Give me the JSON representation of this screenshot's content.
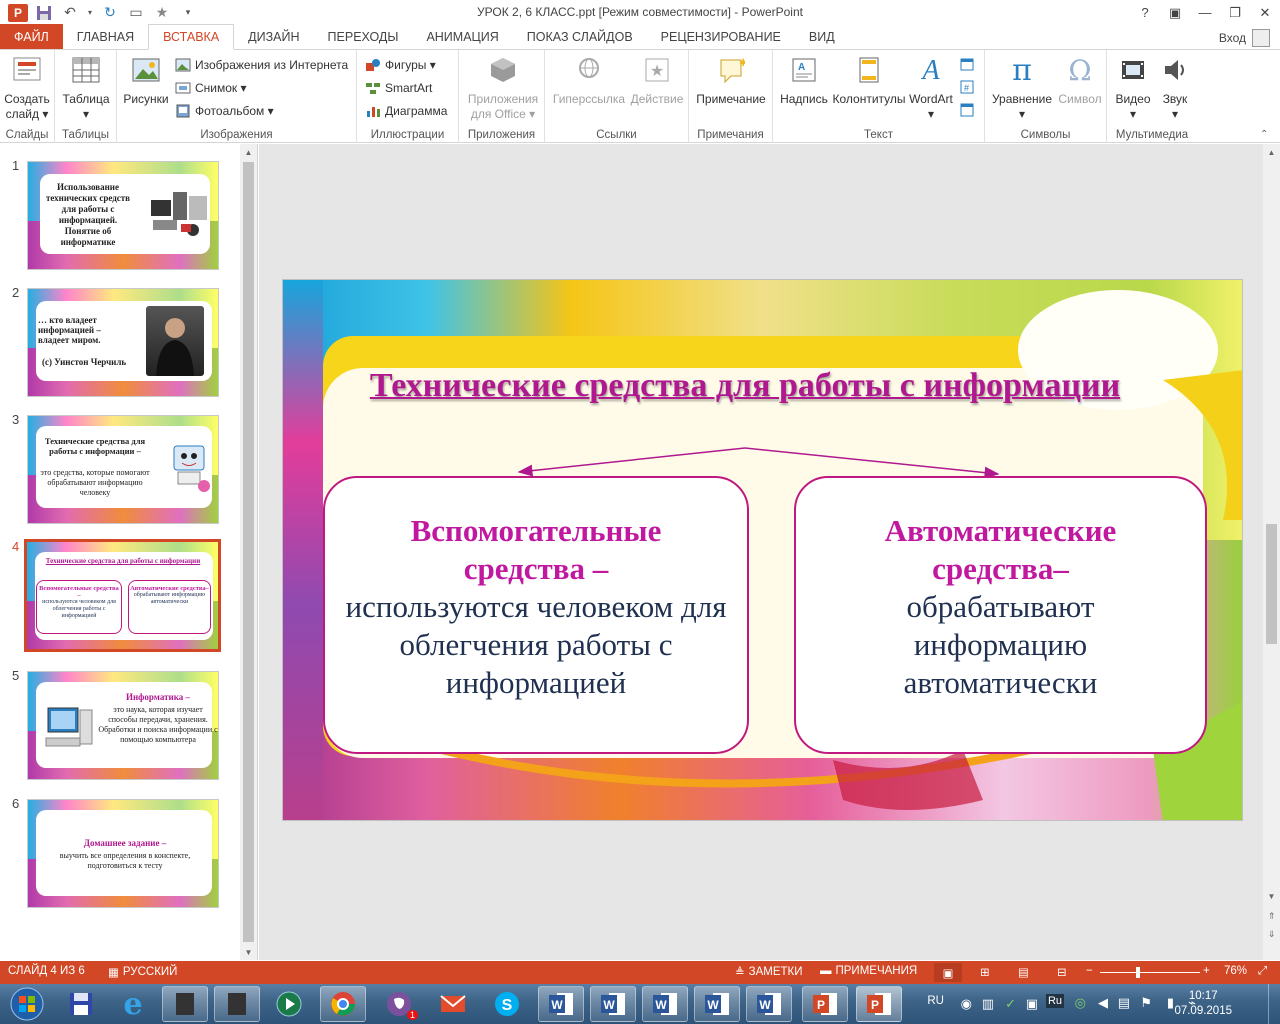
{
  "window": {
    "title": "УРОК 2, 6 КЛАСС.ppt [Режим совместимости] - PowerPoint",
    "controls": [
      "?",
      "▣",
      "—",
      "❐",
      "✕"
    ]
  },
  "tabs": {
    "file": "ФАЙЛ",
    "items": [
      "ГЛАВНАЯ",
      "ВСТАВКА",
      "ДИЗАЙН",
      "ПЕРЕХОДЫ",
      "АНИМАЦИЯ",
      "ПОКАЗ СЛАЙДОВ",
      "РЕЦЕНЗИРОВАНИЕ",
      "ВИД"
    ],
    "active": "ВСТАВКА",
    "signin": "Вход"
  },
  "ribbon": {
    "slides": {
      "label": "Слайды",
      "new_slide": "Создать\nслайд ▾"
    },
    "tables": {
      "label": "Таблицы",
      "table": "Таблица\n▾"
    },
    "images": {
      "label": "Изображения",
      "pictures": "Рисунки",
      "online": "Изображения из Интернета",
      "screenshot": "Снимок ▾",
      "album": "Фотоальбом ▾"
    },
    "illustrations": {
      "label": "Иллюстрации",
      "shapes": "Фигуры ▾",
      "smartart": "SmartArt",
      "chart": "Диаграмма"
    },
    "apps": {
      "label": "Приложения",
      "office_apps": "Приложения\nдля Office ▾"
    },
    "links": {
      "label": "Ссылки",
      "hyperlink": "Гиперссылка",
      "action": "Действие"
    },
    "comments": {
      "label": "Примечания",
      "comment": "Примечание"
    },
    "text": {
      "label": "Текст",
      "textbox": "Надпись",
      "header_footer": "Колонтитулы",
      "wordart": "WordArt\n▾"
    },
    "symbols": {
      "label": "Символы",
      "equation": "Уравнение\n▾",
      "symbol": "Символ"
    },
    "media": {
      "label": "Мультимедиа",
      "video": "Видео\n▾",
      "audio": "Звук\n▾"
    }
  },
  "thumbnails": [
    {
      "num": "1",
      "text": "Использование технических средств для работы с информацией. Понятие об информатике"
    },
    {
      "num": "2",
      "text": "… кто владеет информацией – владеет миром.",
      "text2": "(с) Уинстон Черчиль"
    },
    {
      "num": "3",
      "title": "Технические средства для работы с информации –",
      "text": "это средства, которые помогают обрабатывают информацию человеку"
    },
    {
      "num": "4",
      "title": "Технические средства для работы с информации",
      "left_t": "Вспомогательные средства –",
      "left_d": "используются человеком для облегчения работы с информацией",
      "right_t": "Автоматические средства–",
      "right_d": "обрабатывают информацию автоматически"
    },
    {
      "num": "5",
      "title": "Информатика –",
      "text": "это наука, которая изучает способы передачи, хранения. Обработки и поиска информации с помощью компьютера"
    },
    {
      "num": "6",
      "title": "Домашнее задание –",
      "text": "выучить все определения в конспекте, подготовиться к тесту"
    }
  ],
  "slide": {
    "title": "Технические средства для работы с информации",
    "left": {
      "title": "Вспомогательные средства –",
      "body": "используются человеком для облегчения работы с информацией"
    },
    "right": {
      "title": "Автоматические средства–",
      "body": "обрабатывают информацию автоматически"
    }
  },
  "status": {
    "slide": "СЛАЙД 4 ИЗ 6",
    "lang": "РУССКИЙ",
    "notes": "ЗАМЕТКИ",
    "comments": "ПРИМЕЧАНИЯ",
    "zoom": "76%",
    "zoom_fraction": 0.38
  },
  "taskbar": {
    "tray_lang": "RU",
    "time": "10:17",
    "date": "07.09.2015",
    "viber_badge": "1"
  },
  "colors": {
    "accent": "#d24726",
    "title_pink": "#b0188f",
    "body_navy": "#1f3050"
  }
}
